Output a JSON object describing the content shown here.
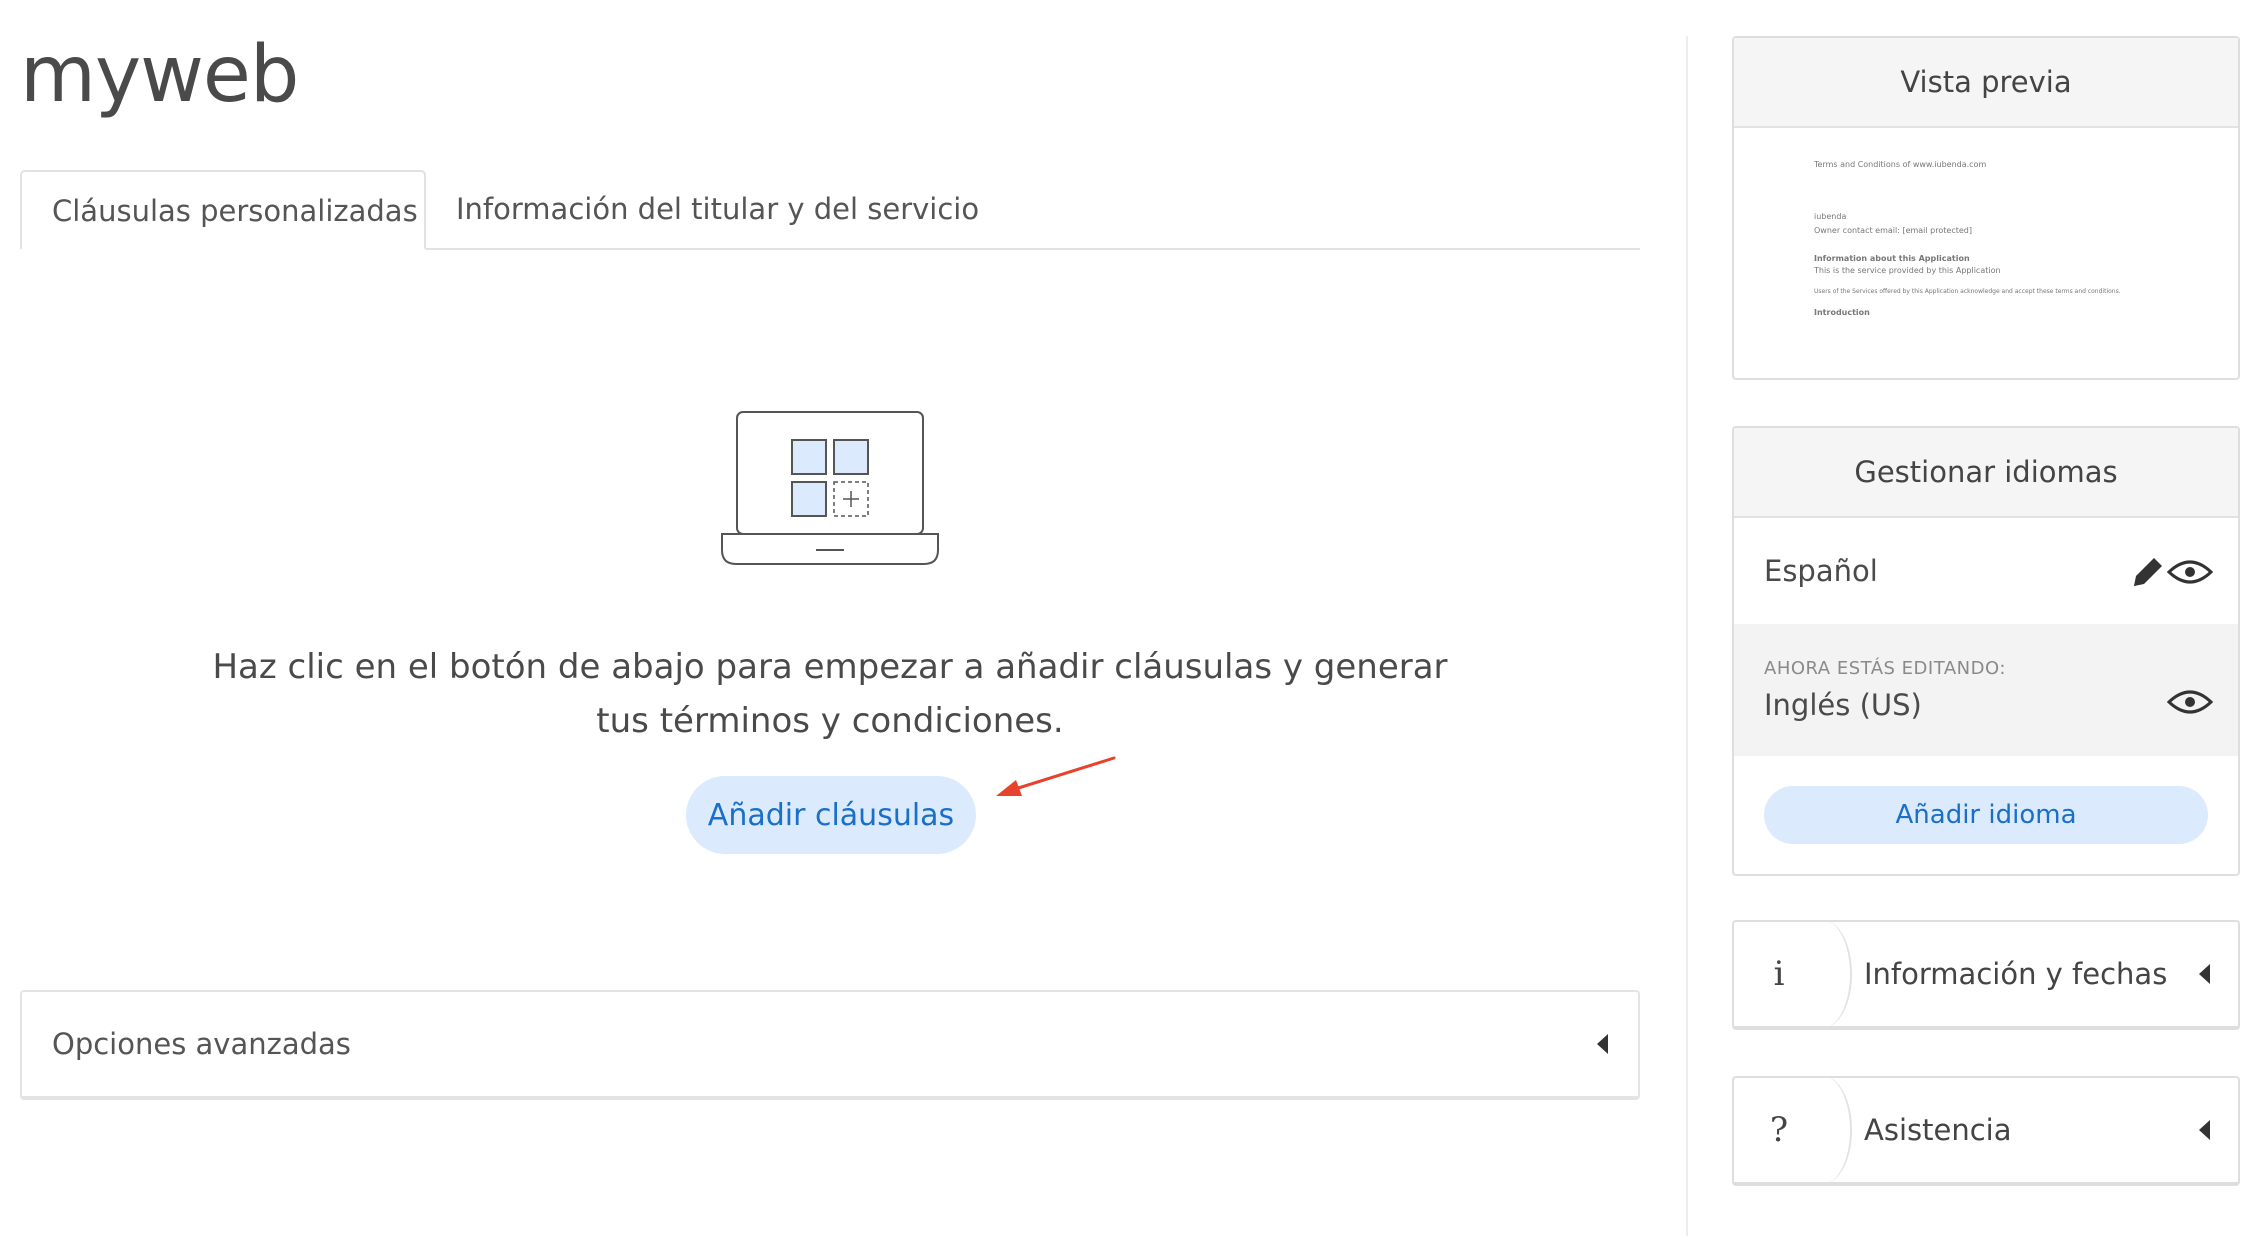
{
  "site_name": "myweb",
  "tabs": [
    {
      "label": "Cláusulas personalizadas",
      "active": true
    },
    {
      "label": "Información del titular y del servicio",
      "active": false
    }
  ],
  "empty_state": {
    "message": "Haz clic en el botón de abajo para empezar a añadir cláusulas y generar tus términos y condiciones.",
    "button_label": "Añadir cláusulas",
    "illustration_icon": "laptop-grid-add-icon"
  },
  "advanced": {
    "label": "Opciones avanzadas"
  },
  "preview": {
    "title": "Vista previa",
    "doc_lines": [
      "Terms and Conditions of www.iubenda.com",
      "iubenda",
      "Owner contact email: [email protected]",
      "Information about this Application",
      "This is the service provided by this Application",
      "Users of the Services offered by this Application acknowledge and accept these terms and conditions.",
      "Introduction"
    ]
  },
  "languages": {
    "title": "Gestionar idiomas",
    "items": [
      {
        "name": "Español"
      }
    ],
    "editing_label": "AHORA ESTÁS EDITANDO:",
    "editing_name": "Inglés (US)",
    "add_label": "Añadir idioma"
  },
  "info_panel": {
    "icon": "i",
    "label": "Información y fechas"
  },
  "help_panel": {
    "icon": "?",
    "label": "Asistencia"
  },
  "colors": {
    "accent": "#1a6fc8",
    "accent_bg": "#dbeafd",
    "arrow": "#e8412c"
  }
}
